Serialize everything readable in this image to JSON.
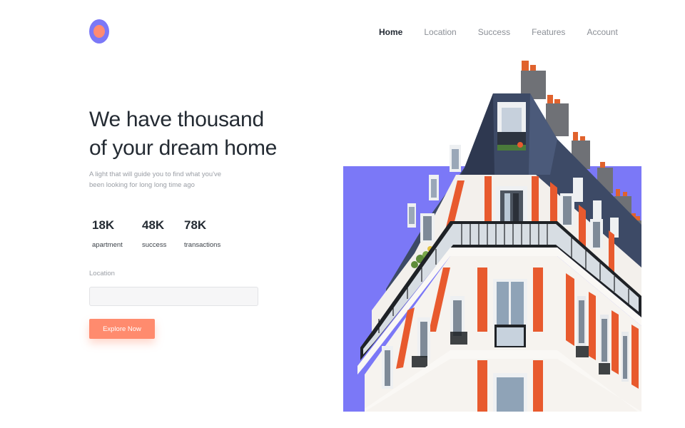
{
  "nav": {
    "items": [
      {
        "label": "Home",
        "active": true
      },
      {
        "label": "Location",
        "active": false
      },
      {
        "label": "Success",
        "active": false
      },
      {
        "label": "Features",
        "active": false
      },
      {
        "label": "Account",
        "active": false
      }
    ]
  },
  "hero": {
    "title_line1": "We have thousand",
    "title_line2": "of your dream home",
    "subtitle_line1": "A light that will guide you to find what you've",
    "subtitle_line2": "been looking for long long time ago"
  },
  "stats": [
    {
      "value": "18K",
      "label": "apartment"
    },
    {
      "value": "48K",
      "label": "success"
    },
    {
      "value": "78K",
      "label": "transactions"
    }
  ],
  "search": {
    "label": "Location",
    "value": "",
    "placeholder": ""
  },
  "cta": {
    "label": "Explore Now"
  },
  "colors": {
    "accent_purple": "#7b78f7",
    "accent_orange": "#ff8b6e",
    "text_dark": "#242b33",
    "text_muted": "#9a9ea5"
  }
}
